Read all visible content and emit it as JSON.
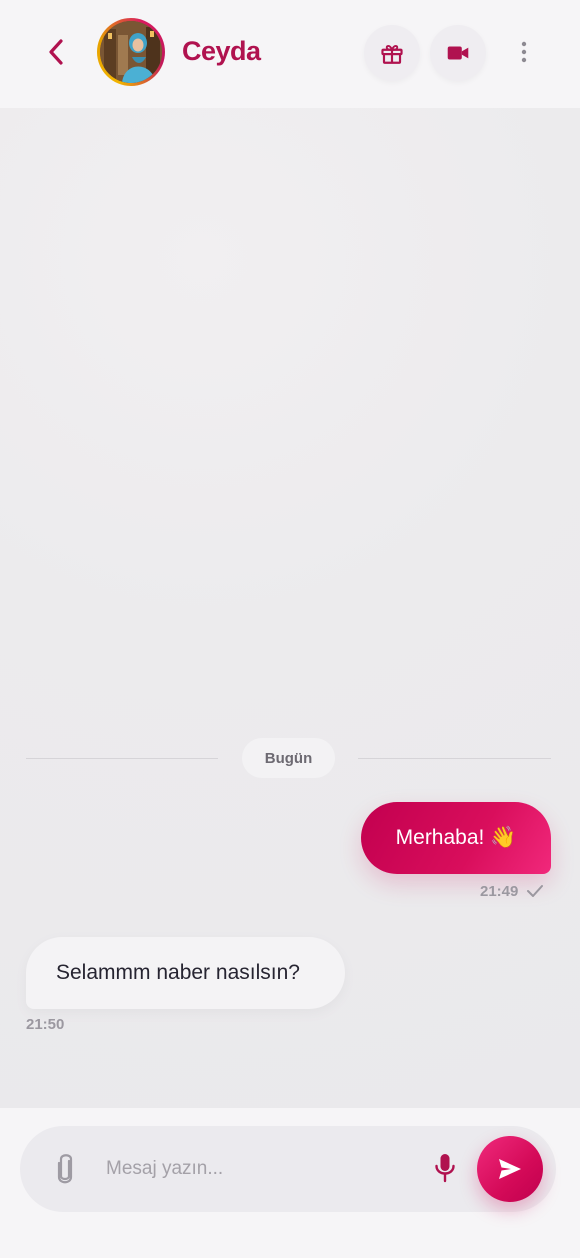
{
  "colors": {
    "accent": "#b0124f",
    "bubble_out": "#d90e5c",
    "bubble_in": "#f4f3f5"
  },
  "header": {
    "contact_name": "Ceyda",
    "icons": [
      "chevron-left-icon",
      "gift-icon",
      "video-camera-icon",
      "more-vertical-icon"
    ]
  },
  "chat": {
    "date_divider": "Bugün",
    "messages": [
      {
        "direction": "outgoing",
        "text": "Merhaba! 👋",
        "time": "21:49",
        "status": "sent"
      },
      {
        "direction": "incoming",
        "text": "Selammm naber nasılsın?",
        "time": "21:50"
      }
    ]
  },
  "composer": {
    "placeholder": "Mesaj yazın...",
    "value": "",
    "icons": [
      "paperclip-icon",
      "microphone-icon",
      "send-icon"
    ]
  }
}
